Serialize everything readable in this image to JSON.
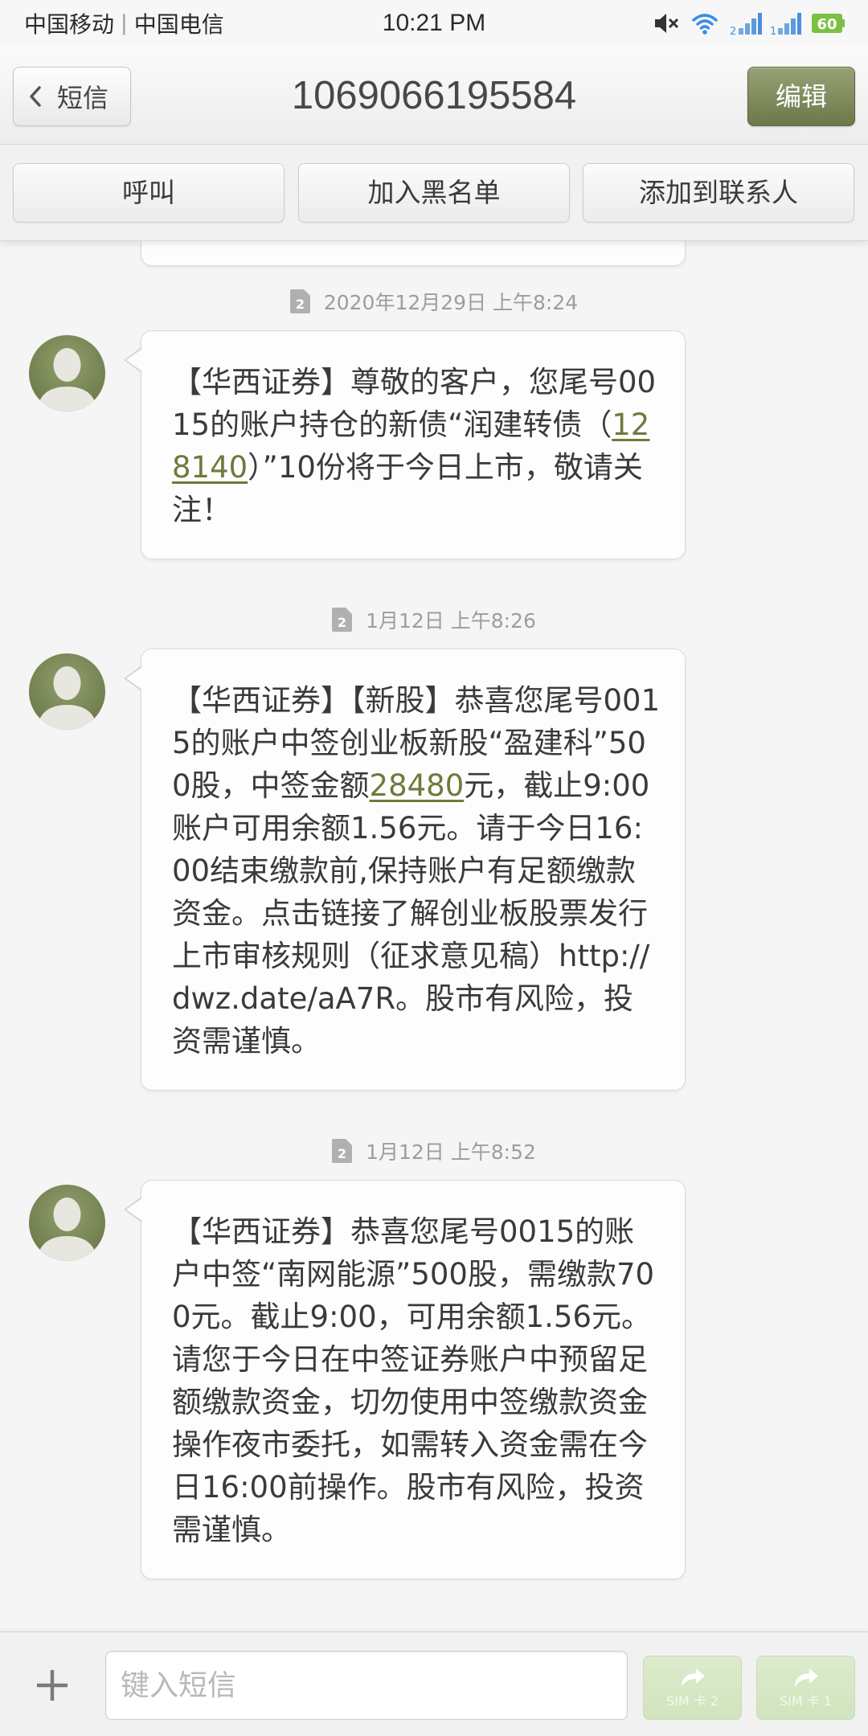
{
  "status_bar": {
    "carrier_1": "中国移动",
    "separator": "|",
    "carrier_2": "中国电信",
    "time": "10:21 PM",
    "signal_a_label": "2",
    "signal_b_label": "1",
    "battery_level": "60",
    "icons": [
      "mute-icon",
      "wifi-icon",
      "signal-icon",
      "signal-icon",
      "battery-icon"
    ]
  },
  "header": {
    "back_icon": "chevron-left-icon",
    "back_label": "短信",
    "title": "1069066195584",
    "edit_label": "编辑"
  },
  "actions": [
    {
      "label": "呼叫"
    },
    {
      "label": "加入黑名单"
    },
    {
      "label": "添加到联系人"
    }
  ],
  "messages": [
    {
      "sim": "2",
      "time": "2020年12月29日 上午8:24",
      "avatar_icon": "contact-avatar-icon",
      "segments": [
        {
          "text": "【华西证券】尊敬的客户，您尾号0015的账户持仓的新债“润建转债（",
          "link": false
        },
        {
          "text": "128140",
          "link": true
        },
        {
          "text": "）”10份将于今日上市，敬请关注！",
          "link": false
        }
      ]
    },
    {
      "sim": "2",
      "time": "1月12日 上午8:26",
      "avatar_icon": "contact-avatar-icon",
      "segments": [
        {
          "text": "【华西证券】【新股】恭喜您尾号0015的账户中签创业板新股“盈建科”500股，中签金额",
          "link": false
        },
        {
          "text": "28480",
          "link": true
        },
        {
          "text": "元，截止9:00账户可用余额1.56元。请于今日16:00结束缴款前,保持账户有足额缴款资金。点击链接了解创业板股票发行上市审核规则（征求意见稿）http://dwz.date/aA7R。股市有风险，投资需谨慎。",
          "link": false
        }
      ]
    },
    {
      "sim": "2",
      "time": "1月12日 上午8:52",
      "avatar_icon": "contact-avatar-icon",
      "segments": [
        {
          "text": "【华西证券】恭喜您尾号0015的账户中签“南网能源”500股，需缴款700元。截止9:00，可用余额1.56元。请您于今日在中签证券账户中预留足额缴款资金，切勿使用中签缴款资金操作夜市委托，如需转入资金需在今日16:00前操作。股市有风险，投资需谨慎。",
          "link": false
        }
      ]
    }
  ],
  "composer": {
    "add_icon": "plus-icon",
    "placeholder": "键入短信",
    "send_icon": "send-arrow-icon",
    "send_buttons": [
      {
        "label": "SIM 卡 2"
      },
      {
        "label": "SIM 卡 1"
      }
    ]
  },
  "colors": {
    "accent": "#76824f",
    "link": "#6d7b3b",
    "send_button": "#d6e7c5",
    "wifi": "#3a8ee6",
    "signal": "#4a8fdc",
    "battery": "#7cc043",
    "avatar": "#7e8b5d"
  }
}
